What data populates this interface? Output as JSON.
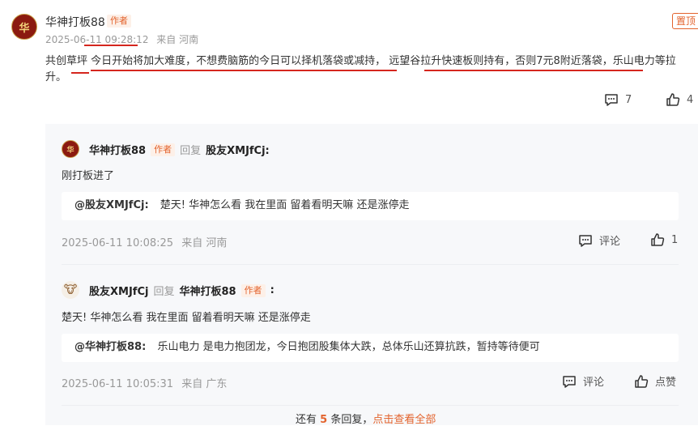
{
  "main_comment": {
    "author": "华神打板88",
    "author_tag": "作者",
    "pinned_label": "置顶",
    "time": "2025-06-11 09:28:12",
    "location": "来自 河南",
    "text": "共创草坪 今日开始将加大难度，不想费脑筋的今日可以择机落袋或减持， 远望谷拉升快速板则持有，否则7元8附近落袋，乐山电力等拉升。",
    "comment_count": "7",
    "like_count": "4"
  },
  "replies": [
    {
      "author": "华神打板88",
      "author_tag": "作者",
      "reply_word": "回复",
      "reply_to": "股友XMJfCj:",
      "text": "刚打板进了",
      "quote_user": "@股友XMJfCj:",
      "quote_text": "楚天! 华神怎么看 我在里面 留着看明天嘛 还是涨停走",
      "time": "2025-06-11 10:08:25",
      "location": "来自 河南",
      "comment_label": "评论",
      "like_label": "1"
    },
    {
      "author": "股友XMJfCj",
      "reply_word": "回复",
      "reply_to": "华神打板88",
      "reply_to_tag": "作者",
      "reply_colon": ":",
      "text": "楚天! 华神怎么看 我在里面 留着看明天嘛 还是涨停走",
      "quote_user": "@华神打板88:",
      "quote_text": "乐山电力 是电力抱团龙，今日抱团股集体大跌，总体乐山还算抗跌，暂持等待便可",
      "time": "2025-06-11 10:05:31",
      "location": "来自 广东",
      "comment_label": "评论",
      "like_label": "点赞"
    }
  ],
  "more_replies": {
    "prefix": "还有",
    "count": "5",
    "suffix": "条回复，",
    "link": "点击查看全部"
  },
  "colors": {
    "accent": "#e3632d",
    "underline": "#d5261e",
    "panel_bg": "#f7f8fa"
  },
  "icons": [
    "comment-icon",
    "thumbs-up-icon"
  ]
}
